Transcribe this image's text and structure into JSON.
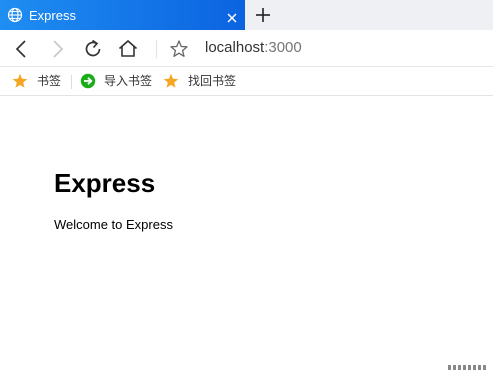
{
  "tab": {
    "title": "Express",
    "icon": "globe-icon"
  },
  "toolbar": {
    "back": "back-arrow-icon",
    "forward": "forward-arrow-icon",
    "reload": "reload-icon",
    "home": "home-icon",
    "star": "star-outline-icon",
    "address_host": "localhost",
    "address_port": ":3000"
  },
  "bookmarks": {
    "items": [
      {
        "label": "书签",
        "icon": "star-icon",
        "color": "#f5a623"
      },
      {
        "label": "导入书签",
        "icon": "import-icon",
        "color": "#1aad19"
      },
      {
        "label": "找回书签",
        "icon": "star-icon",
        "color": "#f5a623"
      }
    ]
  },
  "page": {
    "heading": "Express",
    "message": "Welcome to Express"
  },
  "colors": {
    "tab_active": "#1f8ef2",
    "tabstrip_bg": "#eef0f4"
  }
}
